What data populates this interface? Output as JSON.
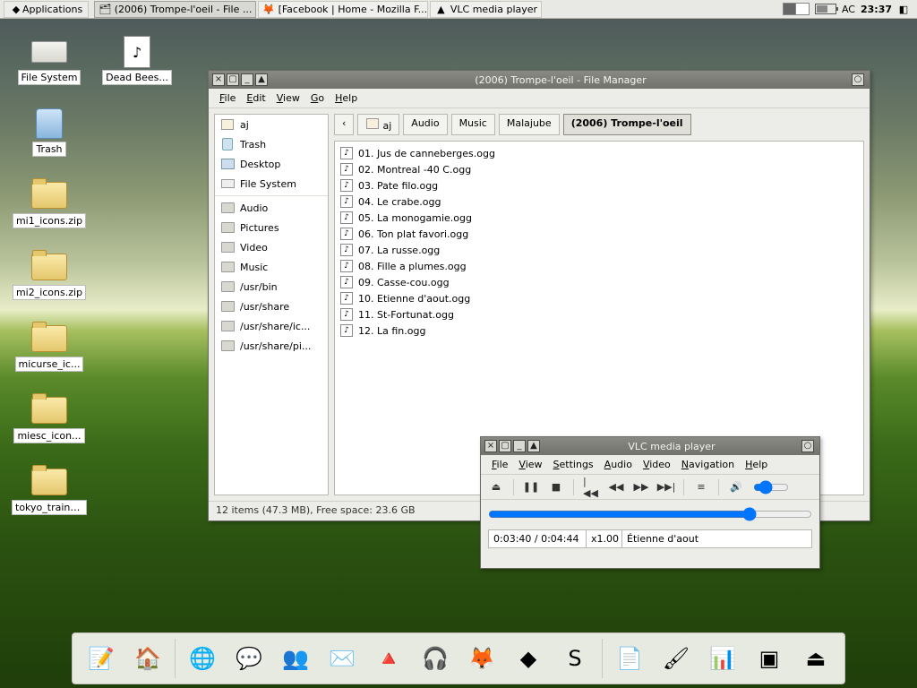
{
  "panel": {
    "applications_label": "Applications",
    "tasks": [
      {
        "label": "(2006) Trompe-l'oeil - File ...",
        "icon": "file-manager-icon",
        "pressed": true
      },
      {
        "label": "[Facebook | Home - Mozilla F...",
        "icon": "firefox-icon",
        "pressed": false
      },
      {
        "label": "VLC media player",
        "icon": "vlc-icon",
        "pressed": false
      }
    ],
    "ac_label": "AC",
    "clock": "23:37"
  },
  "desktop_icons": [
    {
      "name": "file-system",
      "label": "File System",
      "kind": "drive"
    },
    {
      "name": "dead-bees",
      "label": "Dead Bees...",
      "kind": "doc"
    },
    {
      "name": "trash",
      "label": "Trash",
      "kind": "trash"
    },
    {
      "name": "mi1-icons",
      "label": "mi1_icons.zip",
      "kind": "folder"
    },
    {
      "name": "mi2-icons",
      "label": "mi2_icons.zip",
      "kind": "folder"
    },
    {
      "name": "micurse-ic",
      "label": "micurse_ic...",
      "kind": "folder"
    },
    {
      "name": "miesc-icon",
      "label": "miesc_icon...",
      "kind": "folder"
    },
    {
      "name": "tokyo-train",
      "label": "tokyo_train_...",
      "kind": "folder"
    }
  ],
  "fm": {
    "title": "(2006) Trompe-l'oeil - File Manager",
    "menus": [
      "File",
      "Edit",
      "View",
      "Go",
      "Help"
    ],
    "sidebar_groups": [
      [
        {
          "label": "aj",
          "icon": "home"
        },
        {
          "label": "Trash",
          "icon": "trash"
        },
        {
          "label": "Desktop",
          "icon": "desktop"
        },
        {
          "label": "File System",
          "icon": "drive"
        }
      ],
      [
        {
          "label": "Audio",
          "icon": "folder"
        },
        {
          "label": "Pictures",
          "icon": "folder"
        },
        {
          "label": "Video",
          "icon": "folder"
        },
        {
          "label": "Music",
          "icon": "folder"
        },
        {
          "label": "/usr/bin",
          "icon": "folder"
        },
        {
          "label": "/usr/share",
          "icon": "folder"
        },
        {
          "label": "/usr/share/ic...",
          "icon": "folder"
        },
        {
          "label": "/usr/share/pi...",
          "icon": "folder"
        }
      ]
    ],
    "path": [
      "aj",
      "Audio",
      "Music",
      "Malajube",
      "(2006) Trompe-l'oeil"
    ],
    "files": [
      "01. Jus de canneberges.ogg",
      "02. Montreal -40 C.ogg",
      "03. Pate filo.ogg",
      "04. Le crabe.ogg",
      "05. La monogamie.ogg",
      "06. Ton plat favori.ogg",
      "07. La russe.ogg",
      "08. Fille a plumes.ogg",
      "09. Casse-cou.ogg",
      "10. Etienne d'aout.ogg",
      "11. St-Fortunat.ogg",
      "12. La fin.ogg"
    ],
    "status": "12 items (47.3 MB), Free space: 23.6 GB"
  },
  "vlc": {
    "title": "VLC media player",
    "menus": [
      "File",
      "View",
      "Settings",
      "Audio",
      "Video",
      "Navigation",
      "Help"
    ],
    "position_pct": 82,
    "time": "0:03:40 / 0:04:44",
    "rate": "x1.00",
    "track": "Étienne d'aout",
    "volume_pct": 25
  },
  "dock": [
    "text-editor",
    "file-manager",
    "|",
    "web-browser",
    "chat",
    "contacts",
    "mail",
    "vlc",
    "headphones",
    "gimp",
    "inkscape",
    "skype",
    "|",
    "notes",
    "color-picker",
    "office-chart",
    "terminal",
    "eject"
  ]
}
